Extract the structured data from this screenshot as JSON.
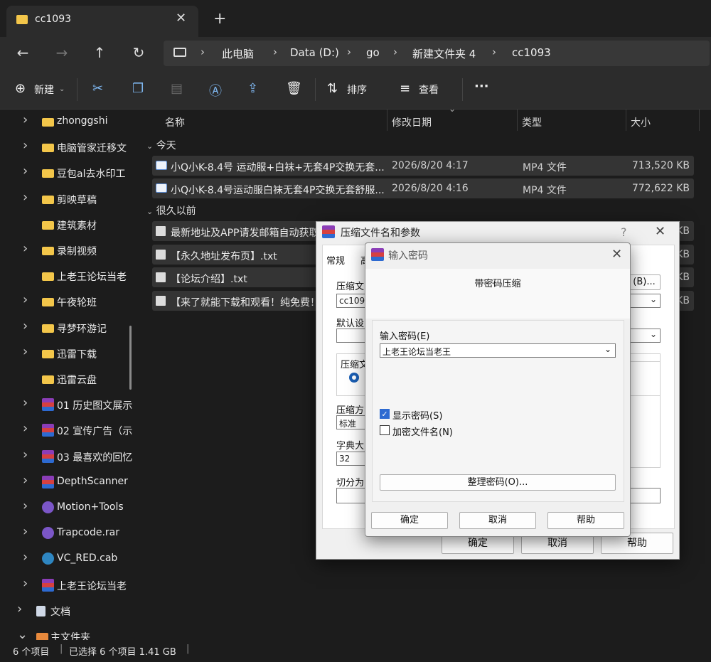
{
  "tab": {
    "title": "cc1093",
    "close": "✕",
    "new": "+"
  },
  "nav": {
    "back": "←",
    "forward": "→",
    "up": "↑",
    "refresh": "↻"
  },
  "breadcrumb": [
    "此电脑",
    "Data (D:)",
    "go",
    "新建文件夹 4",
    "cc1093"
  ],
  "toolbar": {
    "new_label": "新建",
    "sort_label": "排序",
    "view_label": "查看",
    "more": "···"
  },
  "sidebar": {
    "items": [
      {
        "label": "zhonggshi",
        "icon": "folder-icon",
        "chevron": true
      },
      {
        "label": "电脑管家迁移文",
        "icon": "folder-icon",
        "chevron": true
      },
      {
        "label": "豆包al去水印工",
        "icon": "folder-icon",
        "chevron": true
      },
      {
        "label": "剪映草稿",
        "icon": "folder-icon",
        "chevron": true
      },
      {
        "label": "建筑素材",
        "icon": "folder-icon",
        "chevron": false
      },
      {
        "label": "录制视频",
        "icon": "folder-icon",
        "chevron": true
      },
      {
        "label": "上老王论坛当老",
        "icon": "folder-icon",
        "chevron": false
      },
      {
        "label": "午夜轮班",
        "icon": "folder-icon",
        "chevron": true
      },
      {
        "label": "寻梦环游记",
        "icon": "folder-icon",
        "chevron": true
      },
      {
        "label": "迅雷下载",
        "icon": "folder-icon",
        "chevron": true
      },
      {
        "label": "迅雷云盘",
        "icon": "folder-icon",
        "chevron": false
      },
      {
        "label": "01 历史图文展示",
        "icon": "rar-icon",
        "chevron": true
      },
      {
        "label": "02 宣传广告（示",
        "icon": "rar-icon",
        "chevron": true
      },
      {
        "label": "03 最喜欢的回忆",
        "icon": "rar-icon",
        "chevron": true
      },
      {
        "label": "DepthScanner",
        "icon": "rar-icon",
        "chevron": true
      },
      {
        "label": "Motion+Tools",
        "icon": "disc-archive-icon",
        "chevron": true
      },
      {
        "label": "Trapcode.rar",
        "icon": "disc-archive-icon",
        "chevron": true
      },
      {
        "label": "VC_RED.cab",
        "icon": "cab-icon",
        "chevron": true
      },
      {
        "label": "上老王论坛当老",
        "icon": "rar-icon",
        "chevron": true
      },
      {
        "label": "文档",
        "icon": "document-icon",
        "chevron": true
      },
      {
        "label": "主文件夹",
        "icon": "home-icon",
        "chevron": true
      }
    ]
  },
  "columns": {
    "name": "名称",
    "date": "修改日期",
    "type": "类型",
    "size": "大小"
  },
  "groups": {
    "today": "今天",
    "long_ago": "很久以前"
  },
  "files_today": [
    {
      "name": "小Q小K-8.4号 运动服+白袜+无套4P交换无套...",
      "date": "2026/8/20 4:17",
      "type": "MP4 文件",
      "size": "713,520 KB"
    },
    {
      "name": "小Q小K-8.4号运动服白袜无套4P交换无套舒服...",
      "date": "2026/8/20 4:16",
      "type": "MP4 文件",
      "size": "772,622 KB"
    }
  ],
  "files_old": [
    {
      "name": "最新地址及APP请发邮箱自动获取",
      "size": "KB"
    },
    {
      "name": "【永久地址发布页】.txt",
      "size": "KB"
    },
    {
      "name": "【论坛介绍】.txt",
      "size": "KB"
    },
    {
      "name": "【来了就能下载和观看！纯免费！",
      "size": "KB"
    }
  ],
  "status": {
    "count": "6 个项目",
    "selected": "已选择 6 个项目  1.41 GB"
  },
  "archive_dialog": {
    "title": "压缩文件名和参数",
    "help": "?",
    "close": "✕",
    "tab_general": "常规",
    "tab_partial": "高",
    "filename_label": "压缩文",
    "filename_value": "cc1093",
    "browse_button": "(B)...",
    "default_label": "默认设",
    "format_label": "压缩文",
    "method_label": "压缩方",
    "method_value": "标准",
    "dict_label": "字典大",
    "dict_value": "32",
    "split_label": "切分为",
    "ok": "确定",
    "cancel": "取消",
    "help_button": "帮助"
  },
  "password_dialog": {
    "title": "输入密码",
    "close": "✕",
    "heading": "带密码压缩",
    "input_label": "输入密码(E)",
    "password_value": "上老王论坛当老王",
    "show_password": "显示密码(S)",
    "encrypt_names": "加密文件名(N)",
    "organize_button": "整理密码(O)...",
    "ok": "确定",
    "cancel": "取消",
    "help": "帮助"
  }
}
